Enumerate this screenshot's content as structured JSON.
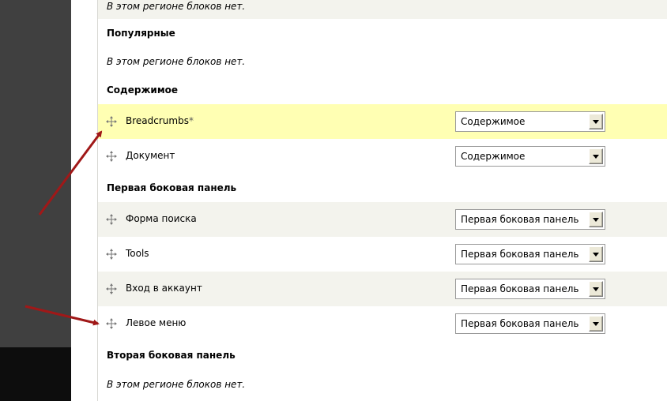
{
  "regions": {
    "top_empty": "В этом регионе блоков нет.",
    "popular": {
      "title": "Популярные",
      "empty": "В этом регионе блоков нет."
    },
    "content": {
      "title": "Содержимое",
      "blocks": [
        {
          "label": "Breadcrumbs",
          "changed_marker": "*",
          "region": "Содержимое"
        },
        {
          "label": "Документ",
          "region": "Содержимое"
        }
      ]
    },
    "sidebar_first": {
      "title": "Первая боковая панель",
      "blocks": [
        {
          "label": "Форма поиска",
          "region": "Первая боковая панель"
        },
        {
          "label": "Tools",
          "region": "Первая боковая панель"
        },
        {
          "label": "Вход в аккаунт",
          "region": "Первая боковая панель"
        },
        {
          "label": "Левое меню",
          "region": "Первая боковая панель"
        }
      ]
    },
    "sidebar_second": {
      "title": "Вторая боковая панель",
      "empty": "В этом регионе блоков нет."
    }
  },
  "colors": {
    "highlight": "#ffffb3",
    "stripe": "#f3f3ed",
    "annotation_arrow": "#a01818"
  }
}
